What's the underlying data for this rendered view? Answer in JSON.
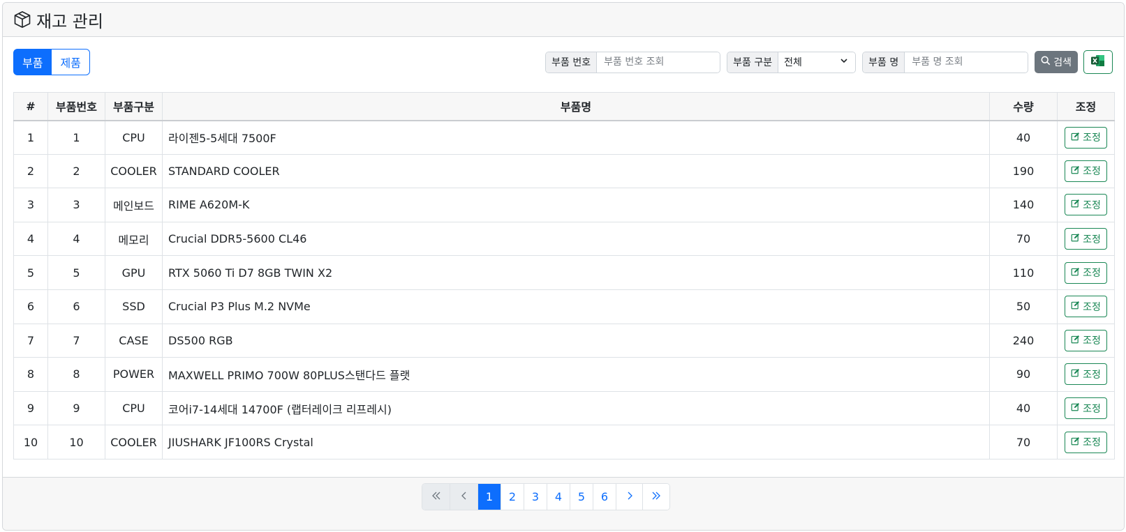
{
  "header": {
    "title": "재고 관리",
    "icon": "box-icon"
  },
  "tabs": [
    {
      "label": "부품",
      "active": true
    },
    {
      "label": "제품",
      "active": false
    }
  ],
  "filters": {
    "part_number": {
      "label": "부품 번호",
      "placeholder": "부품 번호 조회",
      "value": ""
    },
    "category": {
      "label": "부품 구분",
      "value": "전체"
    },
    "part_name": {
      "label": "부품 명",
      "placeholder": "부품 명 조회",
      "value": ""
    },
    "search_label": "검색",
    "excel_icon": "excel-icon"
  },
  "table": {
    "headers": [
      "#",
      "부품번호",
      "부품구분",
      "부품명",
      "수량",
      "조정"
    ],
    "adjust_label": "조정",
    "rows": [
      {
        "no": "1",
        "part_no": "1",
        "category": "CPU",
        "name": "라이젠5-5세대 7500F",
        "qty": "40"
      },
      {
        "no": "2",
        "part_no": "2",
        "category": "COOLER",
        "name": "STANDARD COOLER",
        "qty": "190"
      },
      {
        "no": "3",
        "part_no": "3",
        "category": "메인보드",
        "name": "RIME A620M-K",
        "qty": "140"
      },
      {
        "no": "4",
        "part_no": "4",
        "category": "메모리",
        "name": "Crucial DDR5-5600 CL46",
        "qty": "70"
      },
      {
        "no": "5",
        "part_no": "5",
        "category": "GPU",
        "name": "RTX 5060 Ti D7 8GB TWIN X2",
        "qty": "110"
      },
      {
        "no": "6",
        "part_no": "6",
        "category": "SSD",
        "name": "Crucial P3 Plus M.2 NVMe",
        "qty": "50"
      },
      {
        "no": "7",
        "part_no": "7",
        "category": "CASE",
        "name": "DS500 RGB",
        "qty": "240"
      },
      {
        "no": "8",
        "part_no": "8",
        "category": "POWER",
        "name": "MAXWELL PRIMO 700W 80PLUS스탠다드 플랫",
        "qty": "90"
      },
      {
        "no": "9",
        "part_no": "9",
        "category": "CPU",
        "name": "코어i7-14세대 14700F (랩터레이크 리프레시)",
        "qty": "40"
      },
      {
        "no": "10",
        "part_no": "10",
        "category": "COOLER",
        "name": "JIUSHARK JF100RS Crystal",
        "qty": "70"
      }
    ]
  },
  "pagination": {
    "first": "«",
    "prev": "‹",
    "pages": [
      "1",
      "2",
      "3",
      "4",
      "5",
      "6"
    ],
    "current": "1",
    "next": "›",
    "last": "»"
  },
  "colors": {
    "primary": "#0d6efd",
    "success": "#198754",
    "secondary": "#6c757d"
  }
}
